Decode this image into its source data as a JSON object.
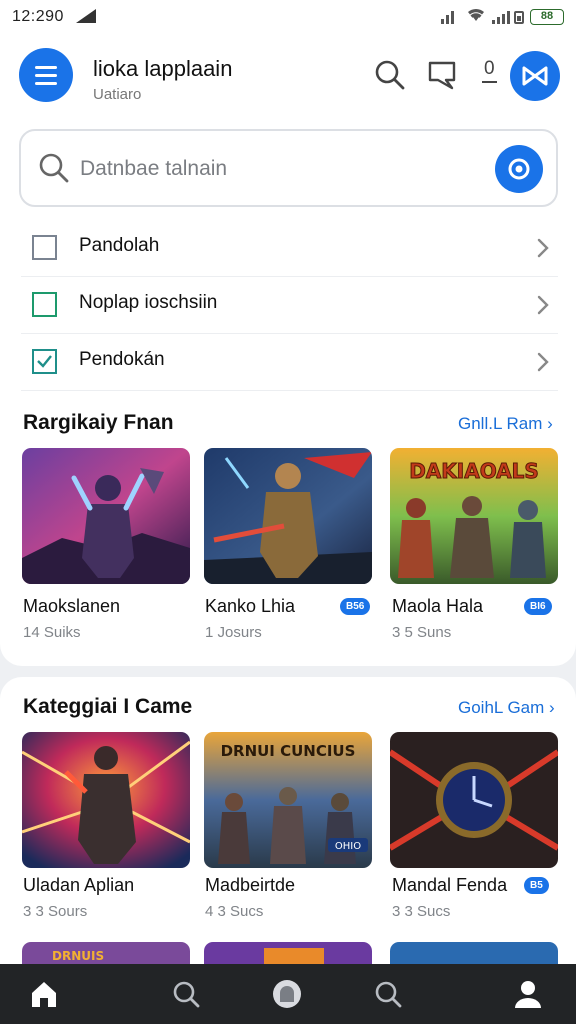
{
  "status_bar": {
    "time": "12:290",
    "battery_label": "88"
  },
  "header": {
    "title": "lioka lapplaain",
    "subtitle": "Uatiaro",
    "counter": "0"
  },
  "search": {
    "placeholder": "Datnbae talnain"
  },
  "menu_items": [
    {
      "label": "Pandolah",
      "checkbox_color": "#7a8391"
    },
    {
      "label": "Noplap ioschsiin",
      "checkbox_color": "#1d9a6c"
    },
    {
      "label": "Pendokán",
      "checkbox_color": "#1f8f8a"
    }
  ],
  "section1": {
    "title": "Rargikaiy Fnan",
    "link": "Gnll.L Ram",
    "games": [
      {
        "name": "Maokslanen",
        "meta": "14 Suiks",
        "badge": "",
        "art_banner": ""
      },
      {
        "name": "Kanko Lhia",
        "meta": "1 Josurs",
        "badge": "B56",
        "art_banner": ""
      },
      {
        "name": "Maola Hala",
        "meta": "3 5 Suns",
        "badge": "BI6",
        "art_banner": "DAKIAOALS"
      }
    ]
  },
  "section2": {
    "title": "Kateggiai I Came",
    "link": "GoihL Gam",
    "games": [
      {
        "name": "Uladan Aplian",
        "meta": "3 3 Sours",
        "badge": "",
        "art_banner": ""
      },
      {
        "name": "Madbeirtde",
        "meta": "4 3 Sucs",
        "badge": "",
        "art_banner": "DRNUI CUNCIUS",
        "art_tag": "OHIO"
      },
      {
        "name": "Mandal Fenda",
        "meta": "3 3 Sucs",
        "badge": "B5",
        "art_banner": ""
      }
    ],
    "next_row_banner": "DRNUIS"
  },
  "colors": {
    "accent": "#1a73e8",
    "nav_bg": "#222426"
  },
  "icons": [
    "menu-icon",
    "search-icon",
    "comment-icon",
    "close-x-icon",
    "camera-icon",
    "chevron-right-icon",
    "home-icon",
    "profile-icon"
  ]
}
